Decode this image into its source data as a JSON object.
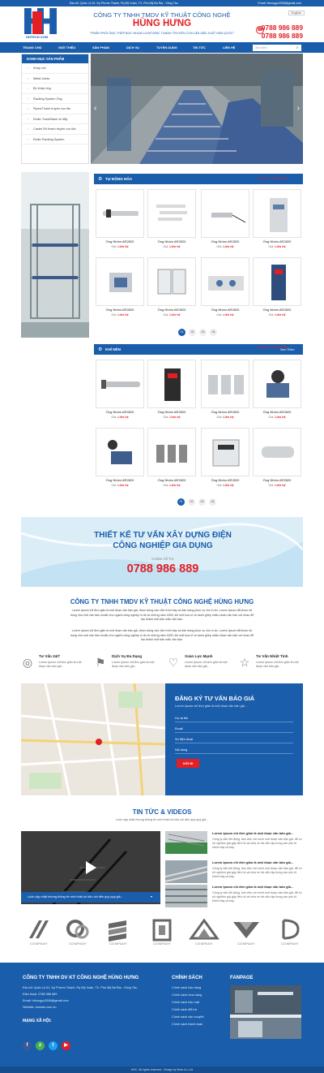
{
  "topbar": {
    "address": "Địa chỉ: Quốc Lộ 51, Kp Phước Thạnh, Pq Mỹ Xuân, TX. Phú Mỹ Bà Rịa - Vũng Tàu",
    "email": "Email: hthungyz2008@gmail.com"
  },
  "header": {
    "logo_text": "HHTECH.COM",
    "company_line": "CÔNG TY TNHH TMDV KỸ THUẬT CÔNG NGHỆ",
    "company_name": "HÙNG HƯNG",
    "slogan": "\"PHÂN PHỐI ỐNG THÉP BỌC NHỰA LOGIFORM, THANH TRUYỀN CON LĂN SẢN XUẤT HÀN QUỐC\"",
    "language": "English",
    "phone1": "0788 986 889",
    "phone2": "0788 986 889"
  },
  "nav": {
    "items": [
      "TRANG CHỦ",
      "GIỚI THIỆU",
      "SẢN PHẨM",
      "DỊCH VỤ",
      "TUYỂN DỤNG",
      "TIN TỨC",
      "LIÊN HỆ"
    ],
    "search_placeholder": "Tìm kiếm"
  },
  "categories": {
    "title": "DANH MỤC SẢN PHẨM",
    "items": [
      "Khớp nối",
      "Metal Joints",
      "Bộ khớp ống",
      "Racking System Ống",
      "Pipes/Thanh truyền con lăn",
      "Roller Track/Bánh xe đẩy",
      "Caster Rộ thanh truyền con lăn",
      "Roller Racking System"
    ]
  },
  "section1": {
    "title": "TỰ ĐỘNG HÓA",
    "hotline_label": "Hotline: 0788 986 889",
    "more": "Xem Thêm"
  },
  "section2": {
    "title": "KHÍ NÉN",
    "hotline_label": "Hotline: 0788 986 889",
    "more": "Xem Thêm"
  },
  "product": {
    "name": "Ống Nhôm AR2820",
    "price_label": "Giá:",
    "price": "Liên hệ"
  },
  "pagination": [
    "01",
    "02",
    "03",
    "04"
  ],
  "banner": {
    "line1": "THIẾT KẾ TƯ VẤN XÂY DỰNG ĐIỆN",
    "line2": "CÔNG NGHIỆP GIA DỤNG",
    "hotline_label": "Hotline Hỗ Trợ",
    "phone": "0788 986 889"
  },
  "about": {
    "title": "CÔNG TY TNHH TMDV KỸ THUẬT CÔNG NGHỆ HÙNG HƯNG",
    "p1": "Lorem Ipsum chỉ đơn giản là một đoạn văn bản giả, được dùng vào việc trình bày và dàn trang phục vụ cho in ấn. Lorem Ipsum đã được sử dụng như một văn bản chuẩn cho ngành công nghiệp in ấn từ những năm 1500, khi một họa sĩ vô danh ghép nhiều đoạn văn bản với nhau để tạo thành một bản mẫu văn bản.",
    "p2": "Lorem Ipsum chỉ đơn giản là một đoạn văn bản giả, được dùng vào việc trình bày và dàn trang phục vụ cho in ấn. Lorem Ipsum đã được sử dụng như một văn bản chuẩn cho ngành công nghiệp in ấn từ những năm 1500, khi một họa sĩ vô danh ghép nhiều đoạn văn bản với nhau để tạo thành một bản mẫu văn bản."
  },
  "features": [
    {
      "title": "Tư Vấn 24/7",
      "desc": "Lorem Ipsum chỉ đơn giản là một đoạn văn bản giả..."
    },
    {
      "title": "Dịch Vụ Đa Dạng",
      "desc": "Lorem Ipsum chỉ đơn giản là một đoạn văn bản giả..."
    },
    {
      "title": "Xoàn Lực Mạnh",
      "desc": "Lorem Ipsum chỉ đơn giản là một đoạn văn bản giả..."
    },
    {
      "title": "Tư Vấn Nhiệt Tình",
      "desc": "Lorem Ipsum chỉ đơn giản là một đoạn văn bản giả..."
    }
  ],
  "form": {
    "title": "ĐĂNG KÝ TƯ VẤN BÁO GIÁ",
    "subtitle": "Lorem Ipsum chỉ đơn giản là một đoạn văn bản giả...",
    "fields": [
      "Họ và tên",
      "Email",
      "Số điện thoại",
      "Nội dung"
    ],
    "submit": "GỬI ĐI"
  },
  "news": {
    "title": "TIN TỨC & VIDEOS",
    "subtitle": "Luôn cập nhật nhưng thông tin mới nhất và hữu ích đến quý quý giả...",
    "video_caption": "Luôn cập nhật nhưng thông tin mới nhất và hữu ích đến quý quý giả...",
    "item_title": "Lorem Ipsum chỉ đơn giản là một đoạn văn bản giả...",
    "item_desc": "Công ty vẫn tiết động. làm việc với mình mới đoạn văn bản giả. để có sử nghiệm giá gây đến hồ và chia xe trả việc tập trung vào yếu tố khinh bày và bày."
  },
  "partners": [
    "COMPANY",
    "COMPANY",
    "COMPANY",
    "COMPANY",
    "COMPANY",
    "COMPANY",
    "COMPANY",
    "COMPANY"
  ],
  "footer": {
    "company": "CÔNG TY TNHH DV KT CÔNG NGHỆ HÙNG HƯNG",
    "lines": [
      "Địa chỉ: Quốc Lộ 51, Kp Phước Thạnh, Pq Mỹ Xuân, TX. Phú Mỹ Bà Rịa - Vũng Tàu",
      "Điện thoại: 0788 986 889",
      "Email: hthungyz2008@gmail.com",
      "Website: domain.com.vn"
    ],
    "social_title": "MẠNG XÃ HỘI:",
    "policy_title": "CHÍNH SÁCH",
    "policies": [
      "Chính sách bảo hàng",
      "Chính sách mua hàng",
      "Chính sách bảo mật",
      "Chính sách đổi trả",
      "Chính sách vận chuyển",
      "Chính sách thanh toán"
    ],
    "fanpage_title": "FANPAGE",
    "copyright": "HHC. All rights reserved . Design by Nina Co.,Ltd"
  },
  "colors": {
    "primary": "#1a5dab",
    "accent": "#e31e24"
  }
}
